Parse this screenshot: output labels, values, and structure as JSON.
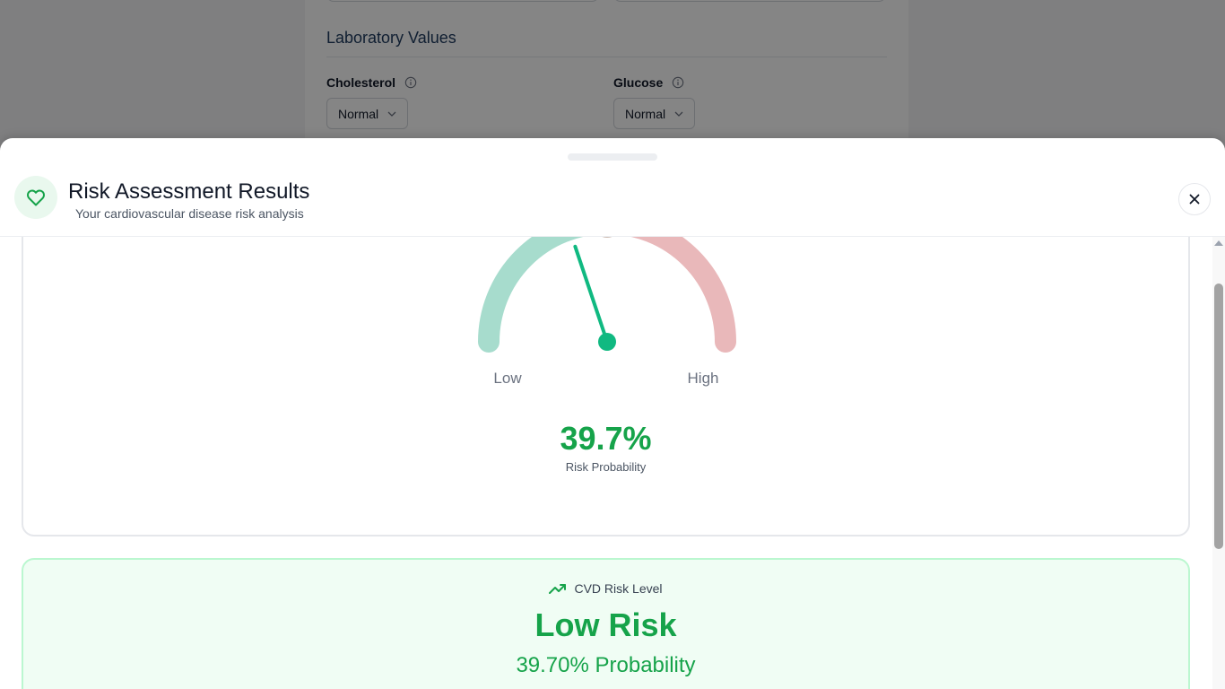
{
  "background": {
    "section_title": "Laboratory Values",
    "fields": [
      {
        "label": "Cholesterol",
        "value": "Normal"
      },
      {
        "label": "Glucose",
        "value": "Normal"
      }
    ]
  },
  "sheet": {
    "title": "Risk Assessment Results",
    "subtitle": "Your cardiovascular disease risk analysis",
    "header_icon": "heart-icon",
    "close_icon": "close-icon"
  },
  "gauge": {
    "value": 39.7,
    "value_label": "39.7%",
    "caption": "Risk Probability",
    "low_label": "Low",
    "high_label": "High",
    "low_color": "#a7dccd",
    "high_color": "#e9b8ba",
    "needle_color": "#10b981"
  },
  "risk": {
    "label": "CVD Risk Level",
    "label_icon": "trending-up-icon",
    "level": "Low Risk",
    "probability_text": "39.70% Probability"
  },
  "colors": {
    "accent": "#16a34a",
    "risk_card_bg": "#f0fdf4",
    "risk_card_border": "#bbf7d0"
  }
}
